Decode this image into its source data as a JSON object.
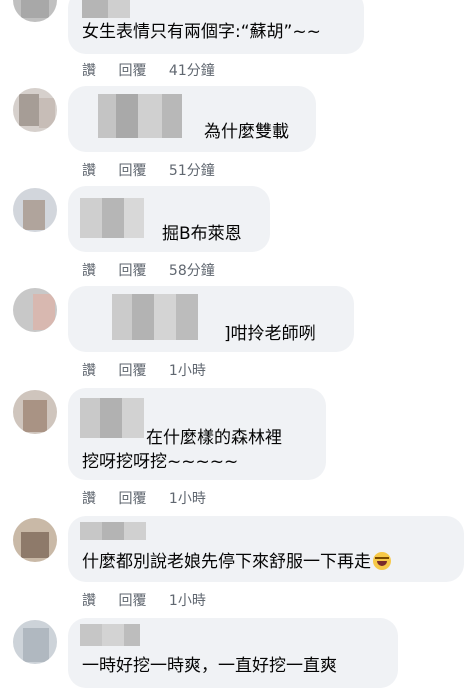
{
  "comments": [
    {
      "text_lines": [
        "女生表情只有兩個字:“蘇胡”~~"
      ],
      "actions": {
        "like": "讚",
        "reply": "回覆",
        "time": "41分鐘"
      }
    },
    {
      "text_lines": [
        "為什麼雙載"
      ],
      "actions": {
        "like": "讚",
        "reply": "回覆",
        "time": "51分鐘"
      }
    },
    {
      "text_lines": [
        "掘B布萊恩"
      ],
      "actions": {
        "like": "讚",
        "reply": "回覆",
        "time": "58分鐘"
      }
    },
    {
      "text_lines": [
        "]咁拎老師咧"
      ],
      "actions": {
        "like": "讚",
        "reply": "回覆",
        "time": "1小時"
      }
    },
    {
      "text_lines": [
        "在什麼樣的森林裡",
        "挖呀挖呀挖~~~~~"
      ],
      "actions": {
        "like": "讚",
        "reply": "回覆",
        "time": "1小時"
      }
    },
    {
      "text_lines": [
        "什麼都別說老娘先停下來舒服一下再走"
      ],
      "emoji": "laughing-crying-emoji",
      "actions": {
        "like": "讚",
        "reply": "回覆",
        "time": "1小時"
      }
    },
    {
      "text_lines": [
        "一時好挖一時爽，一直好挖一直爽"
      ]
    }
  ],
  "colors": {
    "bubble": "#f0f2f5",
    "action_text": "#606770",
    "text": "#050505"
  }
}
